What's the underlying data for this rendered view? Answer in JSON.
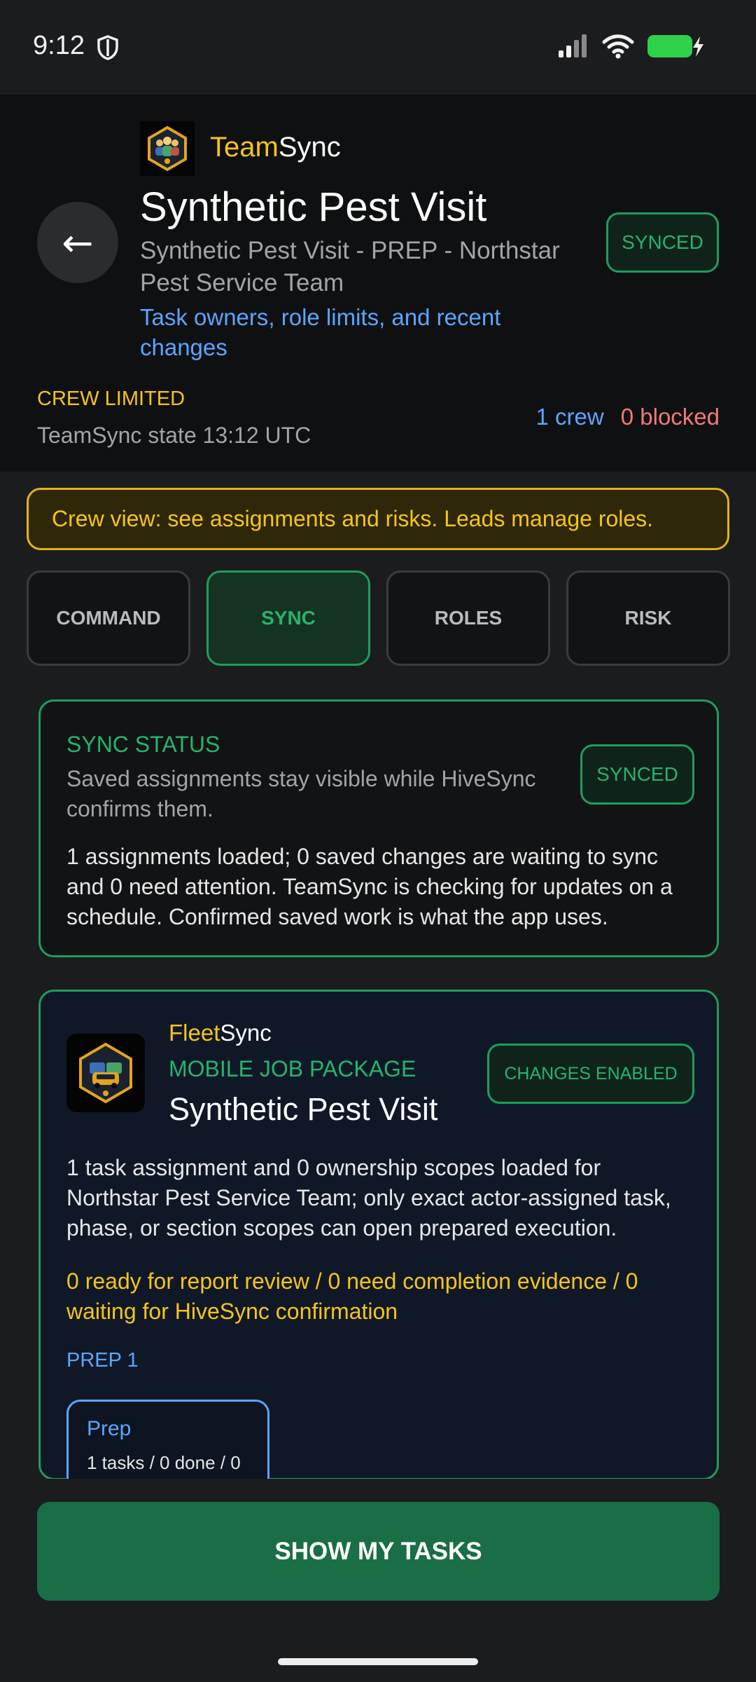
{
  "status_bar": {
    "time": "9:12"
  },
  "header": {
    "brand_prefix": "Team",
    "brand_suffix": "Sync",
    "title": "Synthetic Pest Visit",
    "subtitle": "Synthetic Pest Visit - PREP - Northstar Pest Service Team",
    "link": "Task owners, role limits, and recent changes",
    "sync_badge": "SYNCED",
    "crew_status": "CREW LIMITED",
    "state": "TeamSync state 13:12 UTC",
    "crew_count": "1 crew",
    "blocked_count": "0 blocked",
    "back_glyph": "←"
  },
  "notice": "Crew view: see assignments and risks. Leads manage roles.",
  "tabs": [
    {
      "label": "COMMAND"
    },
    {
      "label": "SYNC"
    },
    {
      "label": "ROLES"
    },
    {
      "label": "RISK"
    }
  ],
  "sync_card": {
    "label": "SYNC STATUS",
    "description": "Saved assignments stay visible while HiveSync confirms them.",
    "badge": "SYNCED",
    "body": "1 assignments loaded; 0 saved changes are waiting to sync and 0 need attention. TeamSync is checking for updates on a schedule. Confirmed saved work is what the app uses."
  },
  "fleet_card": {
    "brand_prefix": "Fleet",
    "brand_suffix": "Sync",
    "kicker": "MOBILE JOB PACKAGE",
    "title": "Synthetic Pest Visit",
    "badge": "CHANGES ENABLED",
    "body": "1 task assignment and 0 ownership scopes loaded for Northstar Pest Service Team; only exact actor-assigned task, phase, or section scopes can open prepared execution.",
    "warning": "0 ready for report review / 0 need completion evidence / 0 waiting for HiveSync confirmation",
    "phase_label": "PREP 1",
    "phase_chip": {
      "name": "Prep",
      "stat": "1 tasks / 0 done / 0"
    }
  },
  "cta": "SHOW MY TASKS",
  "colors": {
    "accent_green": "#1f9d5c",
    "brand_yellow": "#f5c518",
    "link_blue": "#5aa6ff",
    "blocked_red": "#f07a7a"
  }
}
